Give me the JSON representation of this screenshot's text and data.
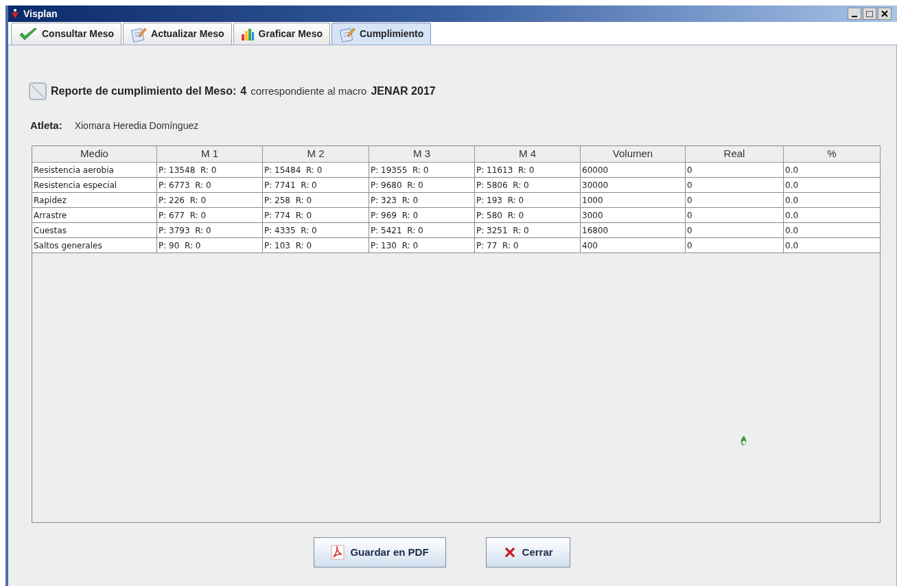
{
  "window": {
    "title": "Visplan"
  },
  "tabs": [
    {
      "label": "Consultar Meso",
      "selected": false
    },
    {
      "label": "Actualizar Meso",
      "selected": false
    },
    {
      "label": "Graficar Meso",
      "selected": false
    },
    {
      "label": "Cumplimiento",
      "selected": true
    }
  ],
  "report": {
    "title": "Reporte de cumplimiento del Meso:",
    "meso": "4",
    "connector": "correspondiente al macro",
    "macro": "JENAR 2017"
  },
  "athlete": {
    "label": "Atleta:",
    "name": "Xiomara Heredia Domínguez"
  },
  "table": {
    "columns": [
      "Medio",
      "M 1",
      "M 2",
      "M 3",
      "M 4",
      "Volumen",
      "Real",
      "%"
    ],
    "rows": [
      [
        "Resistencia aerobia",
        "P: 13548  R: 0",
        "P: 15484  R: 0",
        "P: 19355  R: 0",
        "P: 11613  R: 0",
        "60000",
        "0",
        "0.0"
      ],
      [
        "Resistencia especial",
        "P: 6773  R: 0",
        "P: 7741  R: 0",
        "P: 9680  R: 0",
        "P: 5806  R: 0",
        "30000",
        "0",
        "0.0"
      ],
      [
        "Rapidez",
        "P: 226  R: 0",
        "P: 258  R: 0",
        "P: 323  R: 0",
        "P: 193  R: 0",
        "1000",
        "0",
        "0.0"
      ],
      [
        "Arrastre",
        "P: 677  R: 0",
        "P: 774  R: 0",
        "P: 969  R: 0",
        "P: 580  R: 0",
        "3000",
        "0",
        "0.0"
      ],
      [
        "Cuestas",
        "P: 3793  R: 0",
        "P: 4335  R: 0",
        "P: 5421  R: 0",
        "P: 3251  R: 0",
        "16800",
        "0",
        "0.0"
      ],
      [
        "Saltos generales",
        "P: 90  R: 0",
        "P: 103  R: 0",
        "P: 130  R: 0",
        "P: 77  R: 0",
        "400",
        "0",
        "0.0"
      ]
    ]
  },
  "buttons": [
    {
      "label": "Guardar en PDF",
      "kind": "pdf"
    },
    {
      "label": "Cerrar",
      "kind": "close"
    }
  ]
}
